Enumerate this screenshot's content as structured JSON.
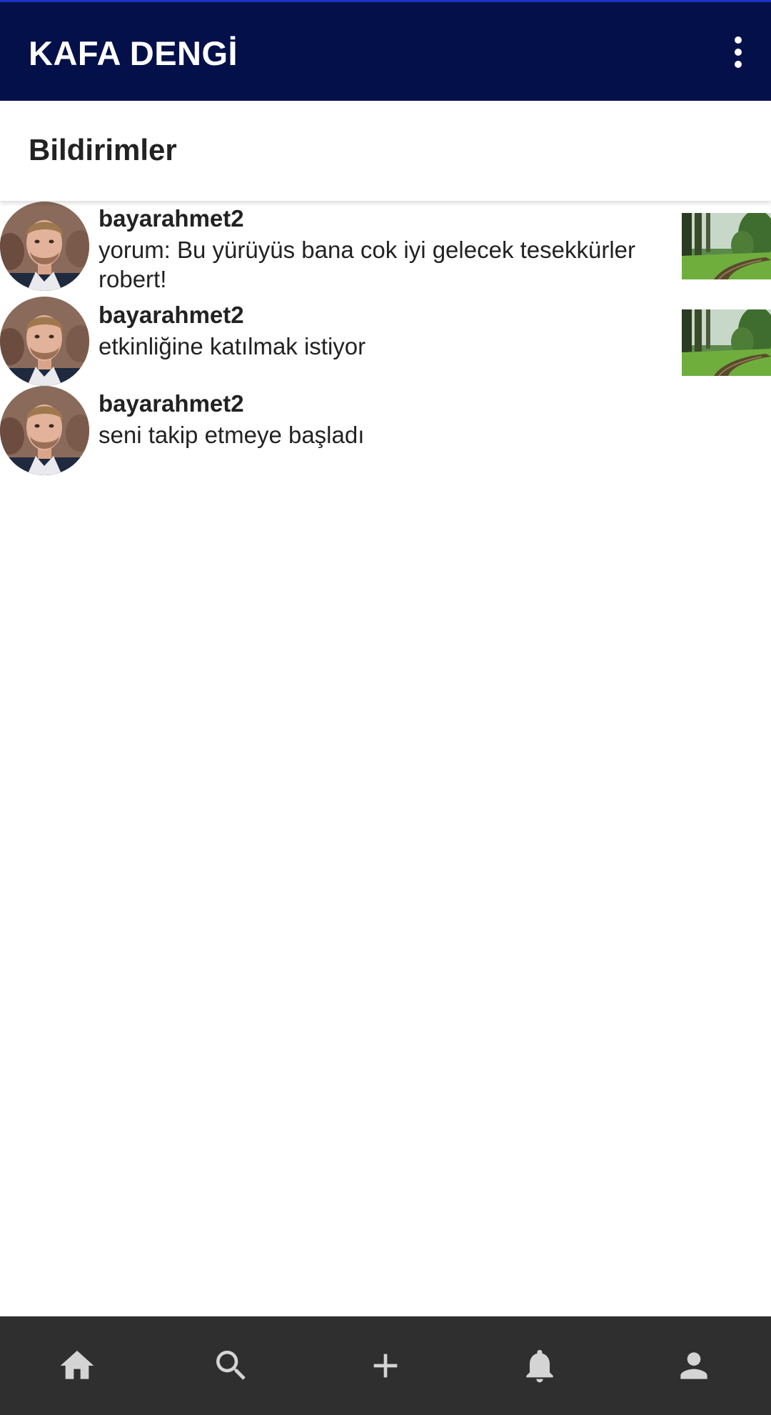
{
  "app_bar": {
    "title": "KAFA DENGİ",
    "menu_icon": "more-vert-icon",
    "background": "#03104a"
  },
  "section": {
    "title": "Bildirimler"
  },
  "notifications": [
    {
      "username": "bayarahmet2",
      "message": "yorum: Bu yürüyüs bana cok iyi gelecek tesekkürler robert!",
      "has_thumbnail": true
    },
    {
      "username": "bayarahmet2",
      "message": "etkinliğine katılmak istiyor",
      "has_thumbnail": true
    },
    {
      "username": "bayarahmet2",
      "message": "seni takip etmeye başladı",
      "has_thumbnail": false
    }
  ],
  "bottom_nav": {
    "background": "#2f2f2f",
    "icon_color": "#d4d4d4",
    "items": [
      {
        "icon": "home-icon"
      },
      {
        "icon": "search-icon"
      },
      {
        "icon": "add-icon"
      },
      {
        "icon": "notifications-icon"
      },
      {
        "icon": "profile-icon"
      }
    ]
  }
}
